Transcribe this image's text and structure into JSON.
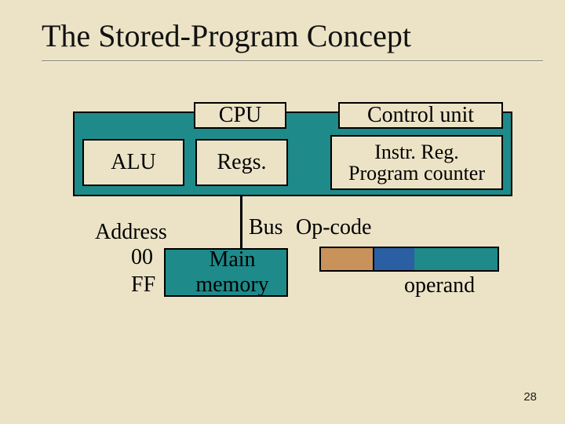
{
  "title": "The Stored-Program Concept",
  "cpu": {
    "header": "CPU",
    "alu": "ALU",
    "regs": "Regs.",
    "control_unit": "Control unit",
    "instr_reg": "Instr. Reg.",
    "program_counter": "Program counter"
  },
  "bus": {
    "label": "Bus",
    "address": "Address",
    "addr_start": "00",
    "addr_end": "FF"
  },
  "memory": {
    "label_line1": "Main",
    "label_line2": "memory"
  },
  "instruction": {
    "opcode_label": "Op-code",
    "operand_label": "operand"
  },
  "page_number": "28"
}
